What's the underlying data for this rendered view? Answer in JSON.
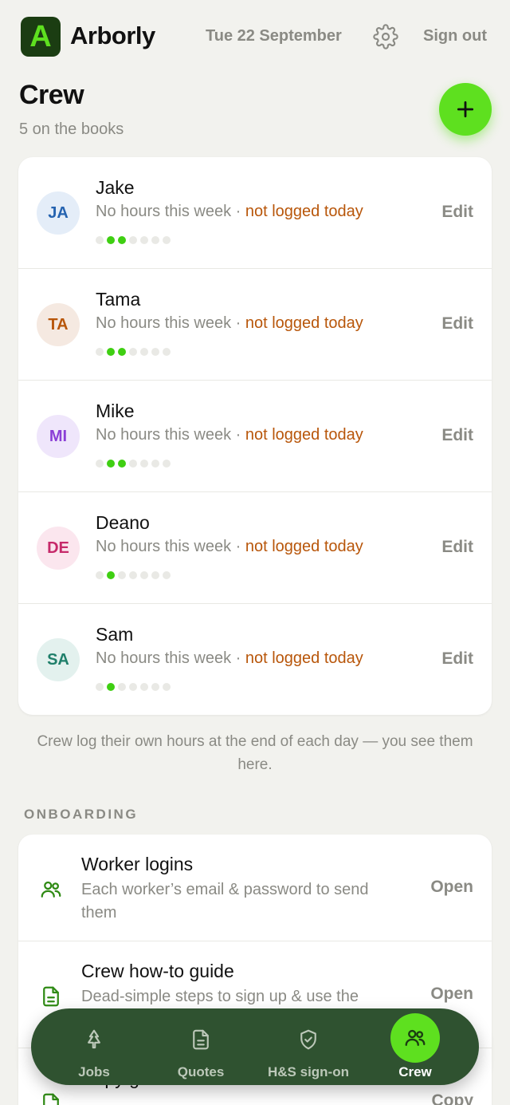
{
  "app": {
    "logo_letter": "A",
    "brand": "Arborly",
    "date": "Tue 22 September",
    "sign_out": "Sign out"
  },
  "page": {
    "title": "Crew",
    "subtitle": "5 on the books"
  },
  "crew": [
    {
      "initials": "JA",
      "name": "Jake",
      "hours": "No hours this week",
      "separator": " · ",
      "status": "not logged today",
      "edit": "Edit",
      "avatar_bg": "#e4edf8",
      "avatar_fg": "#2563b0",
      "dots": [
        0,
        1,
        1,
        0,
        0,
        0,
        0
      ]
    },
    {
      "initials": "TA",
      "name": "Tama",
      "hours": "No hours this week",
      "separator": " · ",
      "status": "not logged today",
      "edit": "Edit",
      "avatar_bg": "#f5e9e1",
      "avatar_fg": "#b8560a",
      "dots": [
        0,
        1,
        1,
        0,
        0,
        0,
        0
      ]
    },
    {
      "initials": "MI",
      "name": "Mike",
      "hours": "No hours this week",
      "separator": " · ",
      "status": "not logged today",
      "edit": "Edit",
      "avatar_bg": "#efe6fb",
      "avatar_fg": "#8b3fd6",
      "dots": [
        0,
        1,
        1,
        0,
        0,
        0,
        0
      ]
    },
    {
      "initials": "DE",
      "name": "Deano",
      "hours": "No hours this week",
      "separator": " · ",
      "status": "not logged today",
      "edit": "Edit",
      "avatar_bg": "#fbe6ee",
      "avatar_fg": "#c62a6a",
      "dots": [
        0,
        1,
        0,
        0,
        0,
        0,
        0
      ]
    },
    {
      "initials": "SA",
      "name": "Sam",
      "hours": "No hours this week",
      "separator": " · ",
      "status": "not logged today",
      "edit": "Edit",
      "avatar_bg": "#e3f1ee",
      "avatar_fg": "#1f7f6a",
      "dots": [
        0,
        1,
        0,
        0,
        0,
        0,
        0
      ]
    }
  ],
  "note": "Crew log their own hours at the end of each day — you see them here.",
  "onboarding": {
    "label": "ONBOARDING",
    "items": [
      {
        "icon": "people-icon",
        "title": "Worker logins",
        "desc": "Each worker’s email & password to send them",
        "action": "Open"
      },
      {
        "icon": "document-icon",
        "title": "Crew how-to guide",
        "desc": "Dead-simple steps to sign up & use the",
        "action": "Open"
      },
      {
        "icon": "document-icon",
        "title": "Copy guide link",
        "desc": "",
        "action": "Copy"
      }
    ]
  },
  "nav": [
    {
      "icon": "tree-icon",
      "label": "Jobs",
      "active": false
    },
    {
      "icon": "document-icon",
      "label": "Quotes",
      "active": false
    },
    {
      "icon": "shield-check-icon",
      "label": "H&S sign-on",
      "active": false
    },
    {
      "icon": "people-icon",
      "label": "Crew",
      "active": true
    }
  ],
  "colors": {
    "accent": "#5ee01f",
    "dark_green": "#2f5230",
    "warning": "#b8560a",
    "muted": "#8a8a84"
  }
}
